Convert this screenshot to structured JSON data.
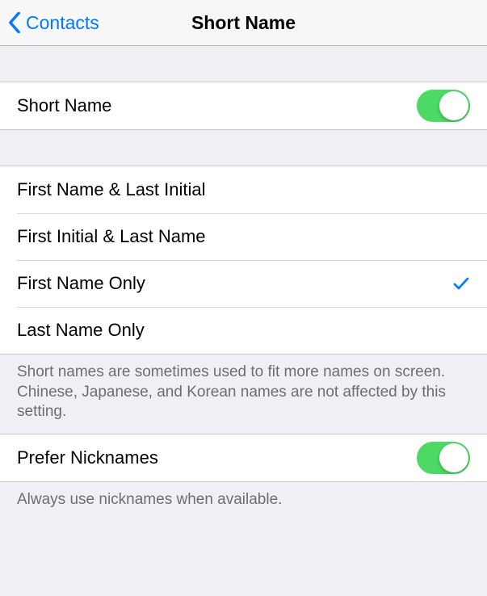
{
  "nav": {
    "back_label": "Contacts",
    "title": "Short Name"
  },
  "sections": {
    "shortNameToggle": {
      "label": "Short Name",
      "enabled": true
    },
    "formatOptions": [
      {
        "label": "First Name & Last Initial",
        "selected": false
      },
      {
        "label": "First Initial & Last Name",
        "selected": false
      },
      {
        "label": "First Name Only",
        "selected": true
      },
      {
        "label": "Last Name Only",
        "selected": false
      }
    ],
    "formatFooter": "Short names are sometimes used to fit more names on screen. Chinese, Japanese, and Korean names are not affected by this setting.",
    "preferNicknames": {
      "label": "Prefer Nicknames",
      "enabled": true
    },
    "nicknamesFooter": "Always use nicknames when available."
  }
}
